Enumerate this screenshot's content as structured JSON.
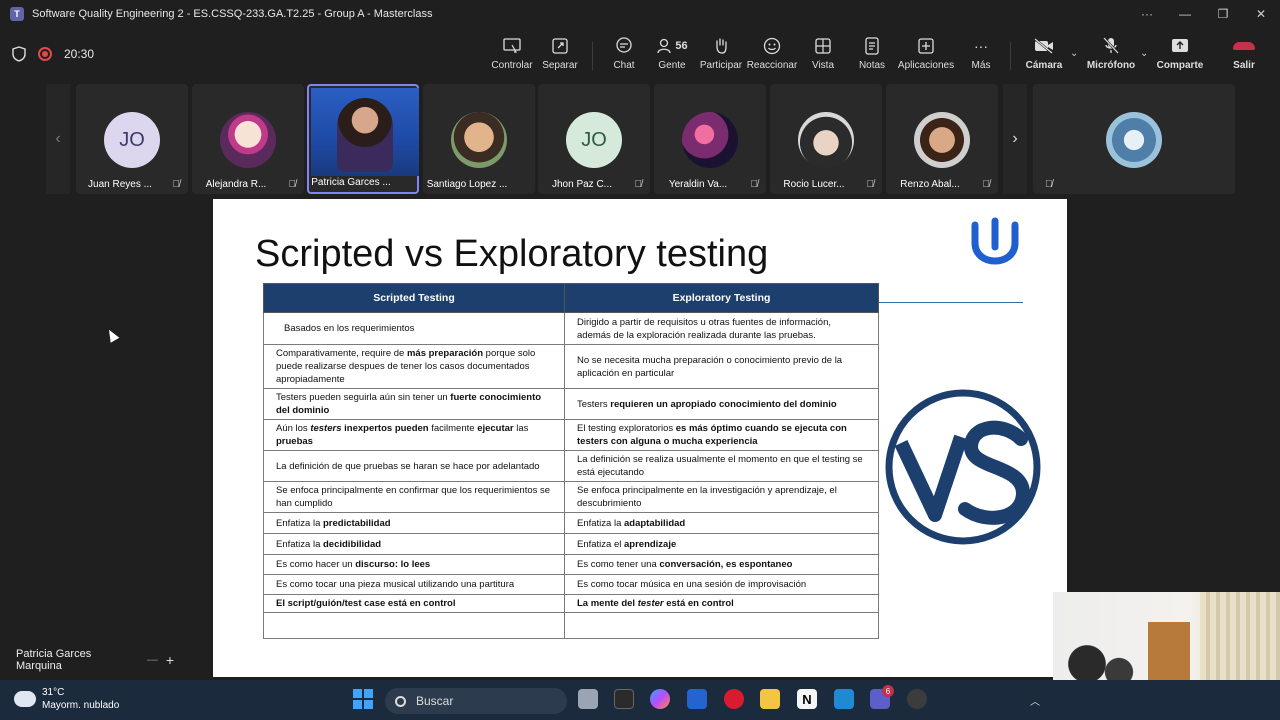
{
  "window": {
    "title": "Software Quality Engineering 2 - ES.CSSQ-233.GA.T2.25 - Group A - Masterclass"
  },
  "toolbar": {
    "timer": "20:30",
    "buttons": {
      "control": "Controlar",
      "popout": "Separar",
      "chat": "Chat",
      "people": "Gente",
      "people_count": "56",
      "raise": "Participar",
      "react": "Reaccionar",
      "view": "Vista",
      "notes": "Notas",
      "apps": "Aplicaciones",
      "more": "Más",
      "camera": "Cámara",
      "mic": "Micrófono",
      "share": "Comparte",
      "leave": "Salir"
    }
  },
  "participants": [
    {
      "name": "Juan Reyes ...",
      "initials": "JO"
    },
    {
      "name": "Alejandra R...",
      "initials": ""
    },
    {
      "name": "Patricia Garces ...",
      "initials": ""
    },
    {
      "name": "Santiago Lopez ...",
      "initials": ""
    },
    {
      "name": "Jhon Paz C...",
      "initials": "JO"
    },
    {
      "name": "Yeraldin Va...",
      "initials": ""
    },
    {
      "name": "Rocio Lucer...",
      "initials": ""
    },
    {
      "name": "Renzo Abal...",
      "initials": ""
    }
  ],
  "slide": {
    "title": "Scripted vs Exploratory testing",
    "headers": [
      "Scripted Testing",
      "Exploratory Testing"
    ],
    "rows": [
      {
        "left": "Basados en los requerimientos",
        "right": "Dirigido a partir de requisitos u otras fuentes de información, además de la exploración realizada durante las pruebas."
      },
      {
        "left_a": "Comparativamente, require de ",
        "left_b": "más preparación",
        "left_c": " porque solo puede realizarse despues de tener los casos documentados apropiadamente",
        "right": "No se necesita mucha preparación o conocimiento previo de la aplicación en particular"
      },
      {
        "left_a": "Testers pueden seguirla aún sin tener un ",
        "left_b": "fuerte conocimiento del dominio",
        "right_a": "Testers ",
        "right_b": "requieren un apropiado conocimiento del dominio"
      },
      {
        "left_a": "Aún los ",
        "left_b": "testers",
        "left_c": " inexpertos pueden",
        "left_d": " facilmente ",
        "left_e": "ejecutar",
        "left_f": " las ",
        "left_g": "pruebas",
        "right_a": "El testing exploratorios ",
        "right_b": "es más óptimo cuando se ejecuta con testers con alguna o mucha experiencia"
      },
      {
        "left": "La definición de que pruebas se haran se hace por adelantado",
        "right": "La definición se realiza usualmente el momento en que el testing se está ejecutando"
      },
      {
        "left": "Se enfoca principalmente en confirmar que los requerimientos se han cumplido",
        "right": "Se enfoca principalmente en la investigación y aprendizaje, el descubrimiento"
      },
      {
        "left_a": "Enfatiza la ",
        "left_b": "predictabilidad",
        "right_a": "Enfatiza la ",
        "right_b": "adaptabilidad"
      },
      {
        "left_a": "Enfatiza la ",
        "left_b": "decidibilidad",
        "right_a": "Enfatiza el ",
        "right_b": "aprendizaje"
      },
      {
        "left_a": "Es como hacer un ",
        "left_b": "discurso: lo lees",
        "right_a": "Es como tener una ",
        "right_b": "conversación, es espontaneo"
      },
      {
        "left": "Es como tocar una pieza musical utilizando una partitura",
        "right": "Es como tocar música en una sesión de improvisación"
      },
      {
        "left_b": "El script/guión/test case está en control",
        "right_b1": "La mente del ",
        "right_i": "tester",
        "right_b2": " está en control"
      }
    ]
  },
  "presenter": {
    "name": "Patricia Garces Marquina"
  },
  "taskbar": {
    "temperature": "31°C",
    "weather": "Mayorm. nublado",
    "search": "Buscar",
    "teams_badge": "6"
  },
  "colors": {
    "accent": "#7f85f5",
    "table_header": "#1c3f6e",
    "leave": "#c4314b",
    "record": "#e04a4a"
  }
}
